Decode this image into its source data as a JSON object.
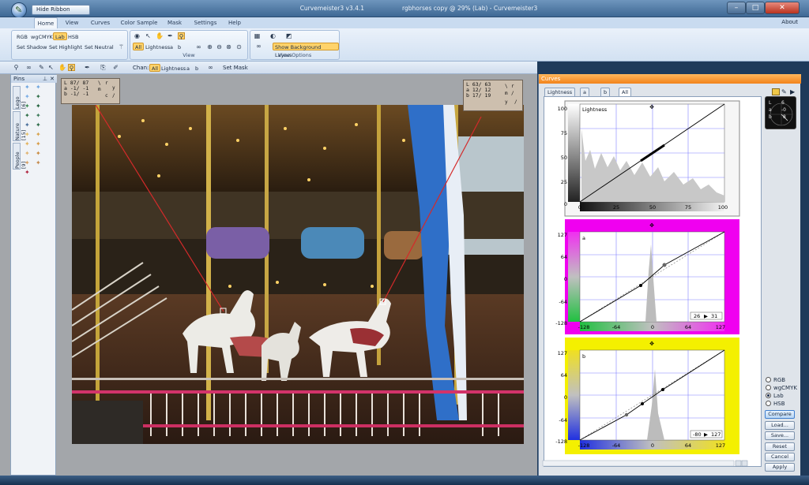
{
  "window": {
    "hide_ribbon": "Hide Ribbon",
    "app_version": "Curvemeister3 v3.4.1",
    "title": "rgbhorses copy @ 29% (Lab) - Curvemeister3"
  },
  "ribbon": {
    "tabs": [
      "Home",
      "View",
      "Curves",
      "Color Sample",
      "Mask",
      "Settings",
      "Help"
    ],
    "about": "About",
    "modes": [
      "RGB",
      "wgCMYK",
      "Lab",
      "HSB"
    ],
    "set_buttons": [
      "Set Shadow",
      "Set Highlight",
      "Set Neutral"
    ],
    "chan_row": [
      "All",
      "Lightness",
      "a",
      "b"
    ],
    "group_view": "View",
    "show_background_layers": "Show Background Layers",
    "group_view_options": "View Options"
  },
  "toolbar": {
    "chan_label": "Chan:",
    "chan": [
      "All",
      "Lightness",
      "a",
      "b"
    ],
    "set_mask": "Set Mask"
  },
  "pins": {
    "title": "Pins",
    "tabs": [
      "Lego [6]",
      "Nature [15]",
      "People [9]"
    ]
  },
  "samples": {
    "left": {
      "rows": [
        "L  87/ 87",
        "a  -1/ -1",
        "b  -1/ -1"
      ],
      "glyphs": [
        "\\",
        "r",
        "m",
        "c",
        "y",
        "/"
      ]
    },
    "right": {
      "rows": [
        "L  63/ 63",
        "a  12/ 12",
        "b  17/ 19"
      ],
      "glyphs": [
        "\\",
        "r",
        "m",
        "/",
        "y",
        "/"
      ]
    }
  },
  "curves": {
    "title": "Curves",
    "tabs": [
      "Lightness",
      "a",
      "b",
      "All"
    ],
    "panels": [
      {
        "label": "Lightness",
        "y_ticks": [
          "100",
          "75",
          "50",
          "25",
          "0"
        ],
        "x_ticks": [
          "0",
          "25",
          "50",
          "75",
          "100"
        ],
        "readout": ""
      },
      {
        "label": "a",
        "y_ticks": [
          "127",
          "64",
          "0",
          "-64",
          "-128"
        ],
        "x_ticks": [
          "-128",
          "-64",
          "0",
          "64",
          "127"
        ],
        "readout": [
          "26",
          "31"
        ]
      },
      {
        "label": "b",
        "y_ticks": [
          "127",
          "64",
          "0",
          "-64",
          "-128"
        ],
        "x_ticks": [
          "-128",
          "-64",
          "0",
          "64",
          "127"
        ],
        "readout": [
          "-80",
          "127"
        ]
      }
    ],
    "mini_scope": [
      "L",
      "6",
      "a",
      "-0",
      "b",
      "8"
    ],
    "radios": [
      "RGB",
      "wgCMYK",
      "Lab",
      "HSB"
    ],
    "selected_radio": "Lab",
    "buttons": [
      "Compare",
      "Load...",
      "Save...",
      "Reset",
      "Cancel",
      "Apply"
    ]
  }
}
